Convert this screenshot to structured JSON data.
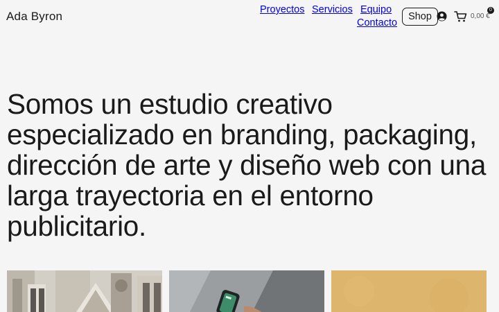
{
  "header": {
    "brand": "Ada Byron",
    "nav": [
      {
        "label": "Proyectos"
      },
      {
        "label": "Servicios"
      },
      {
        "label": "Equipo"
      },
      {
        "label": "Contacto"
      }
    ],
    "shop_label": "Shop",
    "cart": {
      "count": "0",
      "total": "0,00 €"
    }
  },
  "hero": {
    "text": "Somos un estudio creativo especializado en branding, packaging, dirección de arte y diseño web con una larga trayectoria en el entorno publicitario."
  },
  "icons": {
    "account": "account-circle-icon",
    "cart": "shopping-cart-icon"
  },
  "colors": {
    "background": "#f5f5f5",
    "text": "#1a1a1a",
    "thumb_sand": "#e0b96f"
  }
}
